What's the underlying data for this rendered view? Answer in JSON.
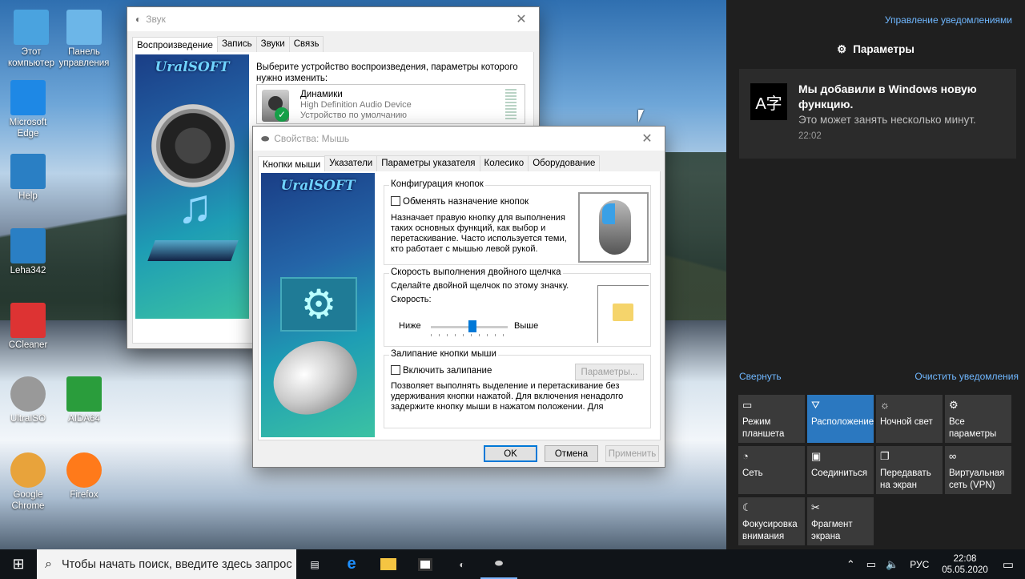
{
  "desktop": {
    "icons": [
      {
        "name": "this-pc-icon",
        "label": "Этот компьютер"
      },
      {
        "name": "control-panel-icon",
        "label": "Панель управления"
      },
      {
        "name": "edge-icon",
        "label": "Microsoft Edge"
      },
      {
        "name": "help-icon",
        "label": "Help"
      },
      {
        "name": "leha-icon",
        "label": "Leha342"
      },
      {
        "name": "ccleaner-icon",
        "label": "CCleaner"
      },
      {
        "name": "ultraiso-icon",
        "label": "UltraISO"
      },
      {
        "name": "aida64-icon",
        "label": "AIDA64"
      },
      {
        "name": "chrome-icon",
        "label": "Google Chrome"
      },
      {
        "name": "firefox-icon",
        "label": "Firefox"
      }
    ]
  },
  "sound_window": {
    "title": "Звук",
    "tabs": [
      "Воспроизведение",
      "Запись",
      "Звуки",
      "Связь"
    ],
    "prompt": "Выберите устройство воспроизведения, параметры которого нужно изменить:",
    "device": {
      "name": "Динамики",
      "driver": "High Definition Audio Device",
      "status": "Устройство по умолчанию"
    },
    "brand": "UralSOFT"
  },
  "mouse_window": {
    "title": "Свойства: Мышь",
    "tabs": [
      "Кнопки мыши",
      "Указатели",
      "Параметры указателя",
      "Колесико",
      "Оборудование"
    ],
    "brand": "UralSOFT",
    "button_config": {
      "title": "Конфигурация кнопок",
      "checkbox": "Обменять назначение кнопок",
      "description": "Назначает правую кнопку для выполнения таких основных функций, как выбор и перетаскивание. Часто используется теми, кто работает с мышью левой рукой."
    },
    "double_click": {
      "title": "Скорость выполнения двойного щелчка",
      "instruction": "Сделайте двойной щелчок по этому значку.",
      "speed_label": "Скорость:",
      "slow": "Ниже",
      "fast": "Выше",
      "slider_value": 0.55
    },
    "click_lock": {
      "title": "Залипание кнопки мыши",
      "checkbox": "Включить залипание",
      "settings_button": "Параметры...",
      "description": "Позволяет выполнять выделение и перетаскивание без удерживания кнопки нажатой. Для включения ненадолго задержите кнопку мыши в нажатом положении. Для"
    },
    "buttons": {
      "ok": "OK",
      "cancel": "Отмена",
      "apply": "Применить"
    }
  },
  "action_center": {
    "manage": "Управление уведомлениями",
    "group_title": "Параметры",
    "notification": {
      "title": "Мы добавили в Windows новую функцию.",
      "body": "Это может занять несколько минут.",
      "time": "22:02"
    },
    "collapse": "Свернуть",
    "clear": "Очистить уведомления",
    "tiles": [
      {
        "name": "tile-tablet-mode",
        "icon": "▭",
        "label": "Режим планшета",
        "on": false
      },
      {
        "name": "tile-location",
        "icon": "⛛",
        "label": "Расположение",
        "on": true
      },
      {
        "name": "tile-night-light",
        "icon": "☼",
        "label": "Ночной свет",
        "on": false
      },
      {
        "name": "tile-all-settings",
        "icon": "⚙",
        "label": "Все параметры",
        "on": false
      },
      {
        "name": "tile-network",
        "icon": "◔",
        "label": "Сеть",
        "on": false
      },
      {
        "name": "tile-connect",
        "icon": "▣",
        "label": "Соединиться",
        "on": false
      },
      {
        "name": "tile-project",
        "icon": "❐",
        "label": "Передавать на экран",
        "on": false
      },
      {
        "name": "tile-vpn",
        "icon": "∞",
        "label": "Виртуальная сеть (VPN)",
        "on": false
      },
      {
        "name": "tile-focus-assist",
        "icon": "☾",
        "label": "Фокусировка внимания",
        "on": false
      },
      {
        "name": "tile-snip",
        "icon": "✂",
        "label": "Фрагмент экрана",
        "on": false
      }
    ]
  },
  "taskbar": {
    "search_placeholder": "Чтобы начать поиск, введите здесь запрос",
    "lang": "РУС",
    "time": "22:08",
    "date": "05.05.2020"
  },
  "colors": {
    "accent": "#0078d7",
    "tile_on": "#2b78c0",
    "ac_bg": "#1f1f1f"
  }
}
